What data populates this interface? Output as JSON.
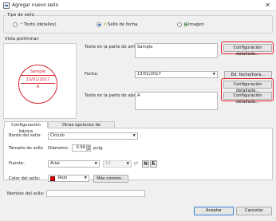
{
  "window": {
    "title": "Agregar nuevo sello",
    "close_glyph": "✕"
  },
  "stamp_type": {
    "group_label": "Tipo de sello",
    "options": [
      {
        "label": "Texto (detalles)",
        "icon": "text-stamp-icon",
        "selected": false
      },
      {
        "label": "Sello de fecha",
        "icon": "date-stamp-icon",
        "selected": true
      },
      {
        "label": "Imagen",
        "icon": "image-stamp-icon",
        "selected": false
      }
    ]
  },
  "preview": {
    "label": "Vista preliminar:",
    "seal": {
      "top": "Sample",
      "middle": "13/01/2017",
      "bottom": "A",
      "color": "#d8242e"
    }
  },
  "fields": {
    "top_text_label": "Texto en la parte de arriba:",
    "top_text_value": "Sample",
    "top_detail_button": "Configuración detallada...",
    "date_label": "Fecha:",
    "date_value": "13/01/2017",
    "date_edit_button": "Ed. fecha/hora...",
    "middle_detail_button": "Configuración detallada...",
    "bottom_text_label": "Texto en la parte de abajo:",
    "bottom_text_value": "A",
    "bottom_detail_button": "Configuración detallada..."
  },
  "tabs": [
    {
      "label": "Configuración básica",
      "active": true
    },
    {
      "label": "Otras opciones de configuración",
      "active": false
    }
  ],
  "basic": {
    "border_label": "Borde del sello:",
    "border_value": "Círculo",
    "size_label": "Tamaño de sello",
    "diameter_label": "Diámetro:",
    "diameter_value": "0.94",
    "unit": "pulg",
    "font_label": "Fuente:",
    "font_value": "Arial",
    "font_size_value": "10",
    "font_size_unit": "pt",
    "bold_glyph": "N",
    "italic_glyph": "K",
    "color_label": "Color del sello:",
    "color_value": "Rojo",
    "color_hex": "#e00000",
    "more_colors_button": "Más colores..."
  },
  "name": {
    "label": "Nombre del sello:",
    "value": ""
  },
  "footer": {
    "ok_button": "Aceptar",
    "cancel_button": "Cancelar"
  },
  "colors": {
    "highlight": "#e21b23",
    "accent": "#1d6fd6"
  }
}
